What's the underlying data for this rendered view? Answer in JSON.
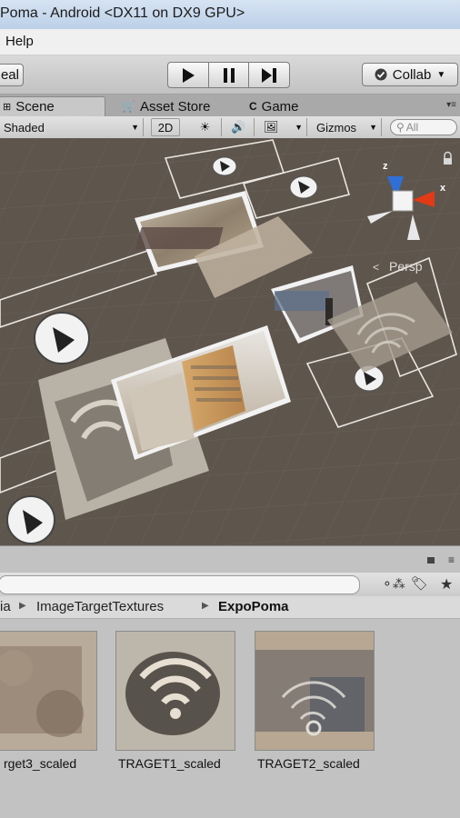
{
  "window": {
    "title": "Poma - Android <DX11 on DX9 GPU>"
  },
  "menu": {
    "help": "Help"
  },
  "toolbar": {
    "left_button": "eal",
    "collab_label": "Collab",
    "play_icon": "play-icon",
    "pause_icon": "pause-icon",
    "step_icon": "step-icon"
  },
  "tabs": {
    "scene": "Scene",
    "asset_store": "Asset Store",
    "game": "Game"
  },
  "scene_toolbar": {
    "shading_mode": "Shaded",
    "mode_2d": "2D",
    "gizmos": "Gizmos",
    "search_placeholder": "All"
  },
  "gizmo": {
    "x": "x",
    "z": "z",
    "view": "Persp"
  },
  "breadcrumb": {
    "items": [
      "ia",
      "ImageTargetTextures",
      "ExpoPoma"
    ]
  },
  "assets": [
    {
      "name": "rget3_scaled"
    },
    {
      "name": "TRAGET1_scaled"
    },
    {
      "name": "TRAGET2_scaled"
    }
  ],
  "colors": {
    "scene_bg": "#5e554d",
    "grid": "#6a625a",
    "frame": "#e9e6e0",
    "gizmo_red": "#e23a16",
    "gizmo_blue": "#2f6fd6"
  }
}
